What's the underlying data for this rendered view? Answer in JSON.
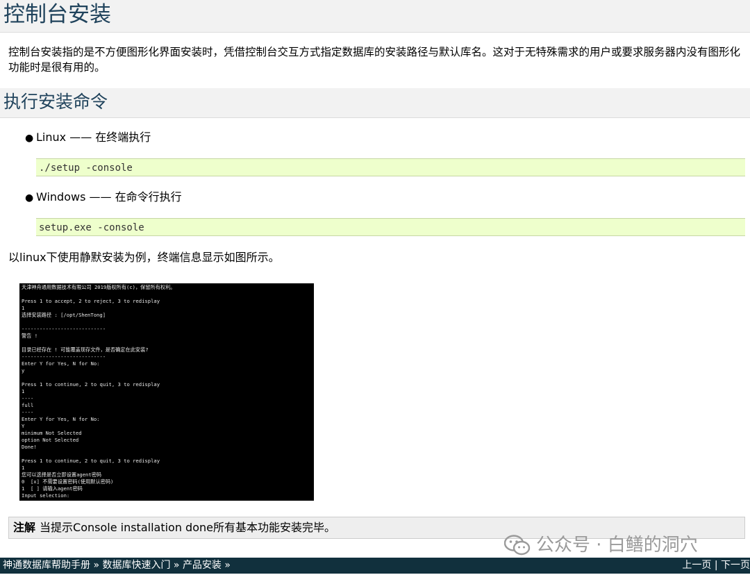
{
  "page": {
    "title": "控制台安装",
    "intro": "控制台安装指的是不方便图形化界面安装时，凭借控制台交互方式指定数据库的安装路径与默认库名。这对于无特殊需求的用户或要求服务器内没有图形化功能时是很有用的。"
  },
  "section": {
    "title": "执行安装命令",
    "items": [
      {
        "label": "Linux —— 在终端执行",
        "code": "./setup -console"
      },
      {
        "label": "Windows —— 在命令行执行",
        "code": "setup.exe -console"
      }
    ],
    "paragraph": "以linux下使用静默安装为例，终端信息显示如图所示。"
  },
  "terminal": {
    "lines": [
      "天津神舟通用数据技术有限公司 2019版权所有(c)，保留所有权利。",
      "",
      "Press 1 to accept, 2 to reject, 3 to redisplay",
      "1",
      "选择安装路径 : [/opt/ShenTong]",
      "",
      "----------------------------",
      "警告 !",
      "",
      "目录已经存在 ! 可能覆盖现存文件，是否确定在此安装?",
      "----------------------------",
      "Enter Y for Yes, N for No:",
      "y",
      "",
      "Press 1 to continue, 2 to quit, 3 to redisplay",
      "1",
      "----",
      "full",
      "----",
      "Enter Y for Yes, N for No:",
      "Y",
      "minimum Not Selected",
      "option Not Selected",
      "Done!",
      "",
      "Press 1 to continue, 2 to quit, 3 to redisplay",
      "1",
      "您可以选择是否立即设置agent密码",
      "0  [x] 不需要设置密码(使用默认密码)",
      "1  [ ] 请输入agent密码",
      "Input selection:"
    ]
  },
  "note": {
    "label": "注解",
    "text": "当提示Console installation done所有基本功能安装完毕。"
  },
  "watermark": {
    "text": "公众号 · 白鳝的洞穴"
  },
  "footer": {
    "crumb1": "神通数据库帮助手册",
    "sep1": " » ",
    "crumb2": "数据库快速入门",
    "sep2": " » ",
    "crumb3": "产品安装",
    "sep3": " »",
    "prev": "上一页",
    "divider": " | ",
    "next": "下一页"
  }
}
